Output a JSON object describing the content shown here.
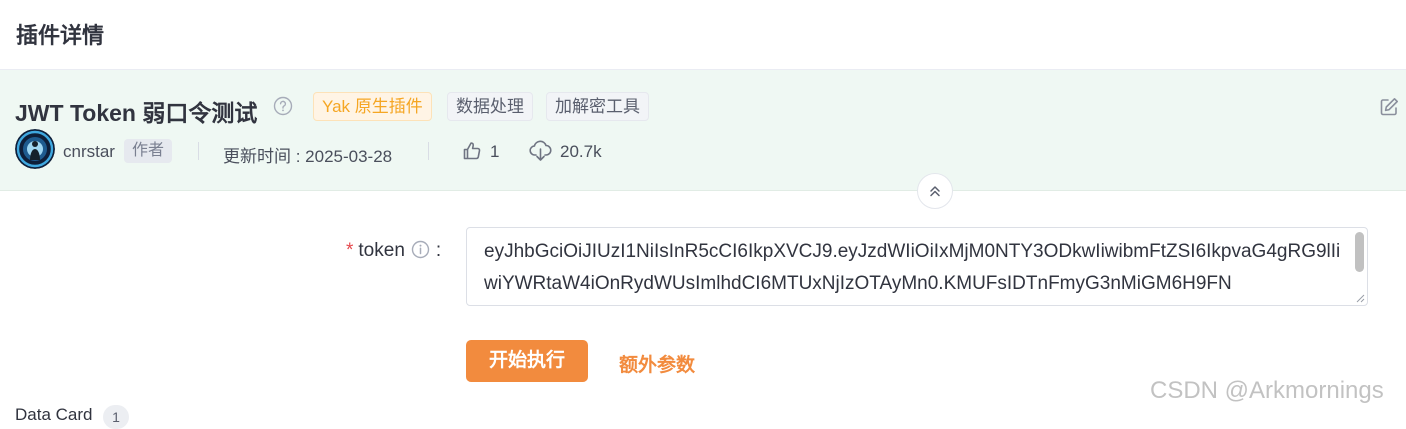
{
  "header": {
    "title": "插件详情"
  },
  "plugin": {
    "name": "JWT Token 弱口令测试",
    "tags": [
      "Yak 原生插件",
      "数据处理",
      "加解密工具"
    ],
    "author": "cnrstar",
    "author_badge": "作者",
    "update_time": "更新时间 : 2025-03-28",
    "likes": "1",
    "downloads": "20.7k"
  },
  "form": {
    "required_mark": "*",
    "label": "token",
    "colon": ":",
    "value": "eyJhbGciOiJIUzI1NiIsInR5cCI6IkpXVCJ9.eyJzdWIiOiIxMjM0NTY3ODkwIiwibmFtZSI6IkpvaG4gRG9lIiwiYWRtaW4iOnRydWUsImlhdCI6MTUxNjIzOTAyMn0.KMUFsIDTnFmyG3nMiGM6H9FN"
  },
  "actions": {
    "start_label": "开始执行",
    "extra_label": "额外参数"
  },
  "data_card": {
    "label": "Data Card",
    "count": "1"
  },
  "watermark": "CSDN @Arkmornings",
  "colors": {
    "accent": "#f28b3e",
    "panel_bg": "#eff8f3",
    "tag_native": "#f5a623"
  },
  "icons": [
    "help-icon",
    "edit-icon",
    "like-icon",
    "download-icon",
    "collapse-up-icon",
    "info-icon"
  ]
}
